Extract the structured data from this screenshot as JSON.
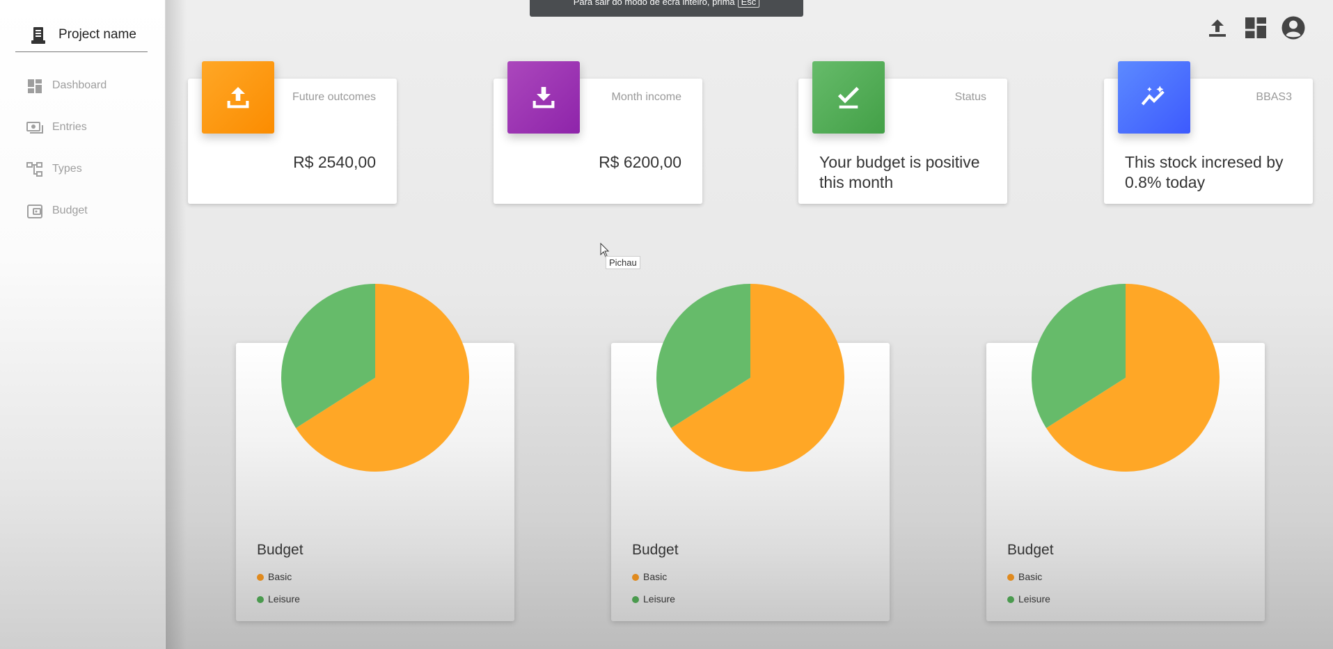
{
  "sidebar": {
    "brand": {
      "label": "Project name",
      "icon": "receipt-icon"
    },
    "items": [
      {
        "label": "Dashboard",
        "icon": "dashboard-icon"
      },
      {
        "label": "Entries",
        "icon": "payments-icon"
      },
      {
        "label": "Types",
        "icon": "hierarchy-icon"
      },
      {
        "label": "Budget",
        "icon": "wallet-icon"
      }
    ]
  },
  "fullscreen_hint": {
    "message": "Para sair do modo de ecrã inteiro, prima",
    "key": "Esc"
  },
  "toolbar": {
    "icons": [
      "upload-icon",
      "dashboard-icon",
      "account-icon"
    ]
  },
  "stats": [
    {
      "label": "Future outcomes",
      "value": "R$ 2540,00",
      "color": "#ff9800",
      "icon": "upload-icon"
    },
    {
      "label": "Month income",
      "value": "R$ 6200,00",
      "color": "#9c27b0",
      "icon": "download-icon"
    },
    {
      "label": "Status",
      "text": "Your budget is positive this month",
      "color": "#4caf50",
      "icon": "check-icon"
    },
    {
      "label": "BBAS3",
      "text": "This stock incresed by 0.8% today",
      "color": "#4d79ff",
      "icon": "trending-icon"
    }
  ],
  "budget_cards": [
    {
      "title": "Budget",
      "legend": [
        "Basic",
        "Leisure"
      ]
    },
    {
      "title": "Budget",
      "legend": [
        "Basic",
        "Leisure"
      ]
    },
    {
      "title": "Budget",
      "legend": [
        "Basic",
        "Leisure"
      ]
    }
  ],
  "chart_data": [
    {
      "type": "pie",
      "categories": [
        "Basic",
        "Leisure"
      ],
      "values": [
        66,
        34
      ],
      "colors": [
        "#ffa726",
        "#66bb6a"
      ]
    },
    {
      "type": "pie",
      "categories": [
        "Basic",
        "Leisure"
      ],
      "values": [
        66,
        34
      ],
      "colors": [
        "#ffa726",
        "#66bb6a"
      ]
    },
    {
      "type": "pie",
      "categories": [
        "Basic",
        "Leisure"
      ],
      "values": [
        66,
        34
      ],
      "colors": [
        "#ffa726",
        "#66bb6a"
      ]
    }
  ],
  "tooltip": {
    "text": "Pichau"
  }
}
